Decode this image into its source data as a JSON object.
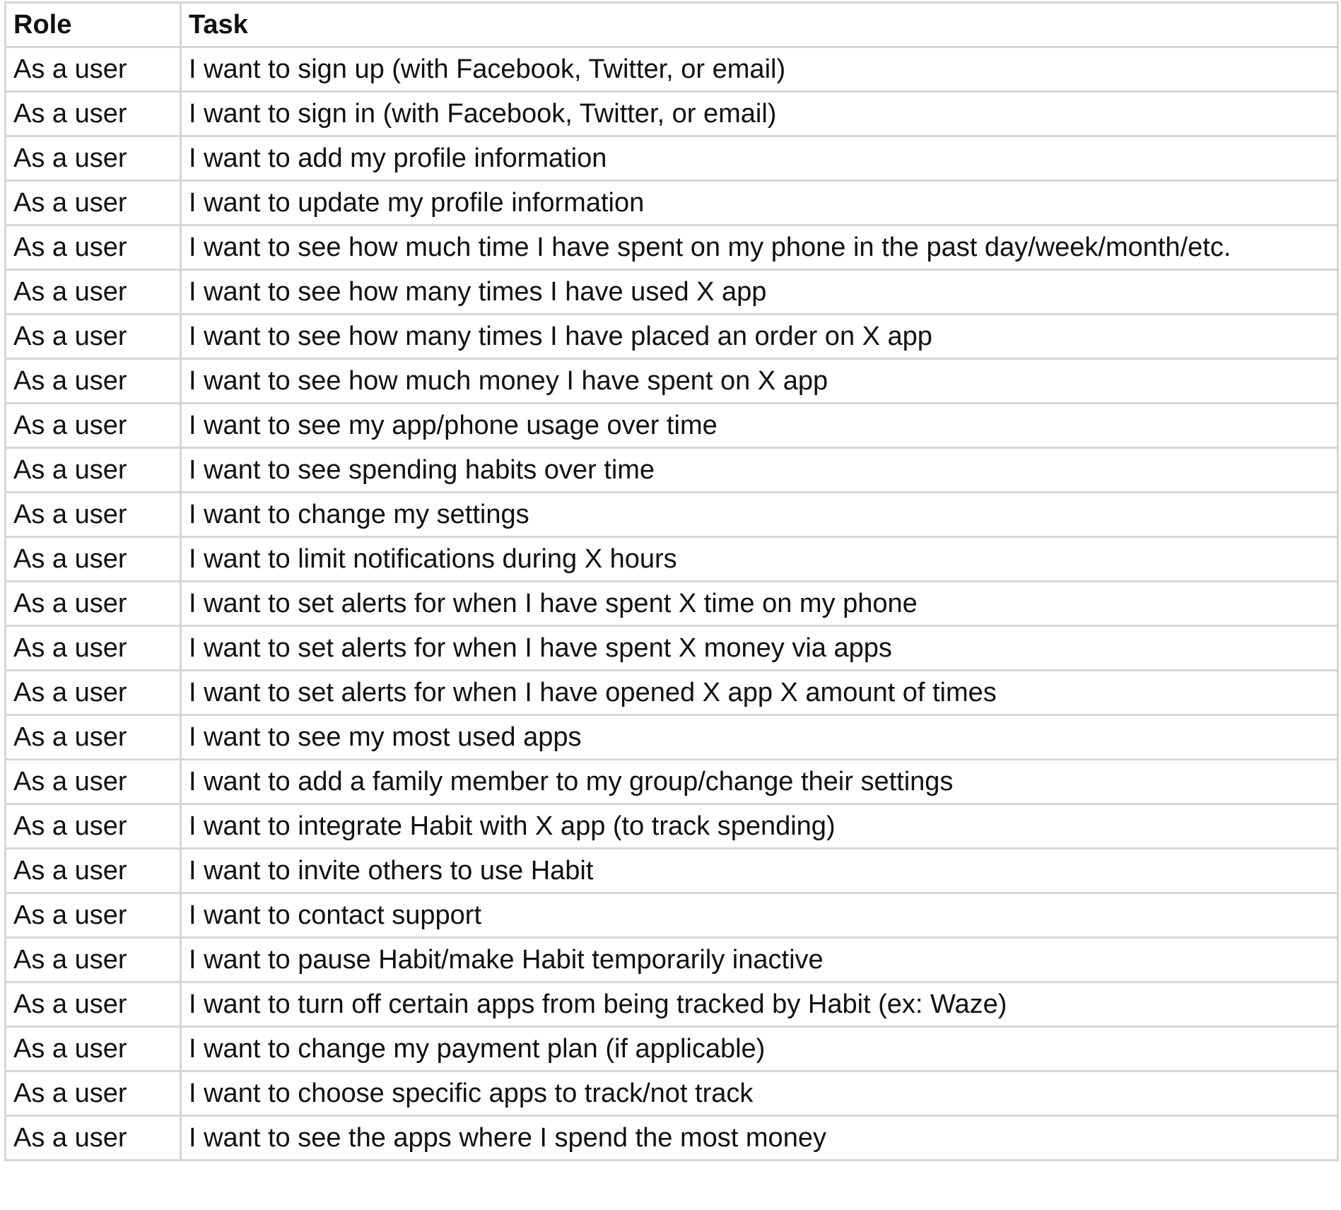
{
  "table": {
    "headers": {
      "role": "Role",
      "task": "Task"
    },
    "rows": [
      {
        "role": "As a user",
        "task": "I want to sign up (with Facebook, Twitter, or email)"
      },
      {
        "role": "As a user",
        "task": "I want to sign in (with Facebook, Twitter, or email)"
      },
      {
        "role": "As a user",
        "task": "I want to add my profile information"
      },
      {
        "role": "As a user",
        "task": "I want to update my profile information"
      },
      {
        "role": "As a user",
        "task": "I want to see how much time I have spent on my phone in the past day/week/month/etc."
      },
      {
        "role": "As a user",
        "task": "I want to see how many times I have used X app"
      },
      {
        "role": "As a user",
        "task": "I want to see how many times I have placed an order on X app"
      },
      {
        "role": "As a user",
        "task": "I want to see how much money I have spent on X app"
      },
      {
        "role": "As a user",
        "task": "I want to see my app/phone usage over time"
      },
      {
        "role": "As a user",
        "task": "I want to see spending habits over time"
      },
      {
        "role": "As a user",
        "task": "I want to change my settings"
      },
      {
        "role": "As a user",
        "task": "I want to limit notifications during X hours"
      },
      {
        "role": "As a user",
        "task": "I want to set alerts for when I have spent X time on my phone"
      },
      {
        "role": "As a user",
        "task": "I want to set alerts for when I have spent X money via apps"
      },
      {
        "role": "As a user",
        "task": "I want to set alerts for when I have opened X app X amount of times"
      },
      {
        "role": "As a user",
        "task": "I want to see my most used apps"
      },
      {
        "role": "As a user",
        "task": "I want to add a family member to my group/change their settings"
      },
      {
        "role": "As a user",
        "task": "I want to integrate Habit with X app (to track spending)"
      },
      {
        "role": "As a user",
        "task": "I want to invite others to use Habit"
      },
      {
        "role": "As a user",
        "task": "I want to contact support"
      },
      {
        "role": "As a user",
        "task": "I want to pause Habit/make Habit temporarily inactive"
      },
      {
        "role": "As a user",
        "task": "I want to turn off certain apps from being tracked by Habit (ex: Waze)"
      },
      {
        "role": "As a user",
        "task": "I want to change my payment plan (if applicable)"
      },
      {
        "role": "As a user",
        "task": "I want to choose specific apps to track/not track"
      },
      {
        "role": "As a user",
        "task": "I want to see the apps where I spend the most money"
      }
    ]
  }
}
